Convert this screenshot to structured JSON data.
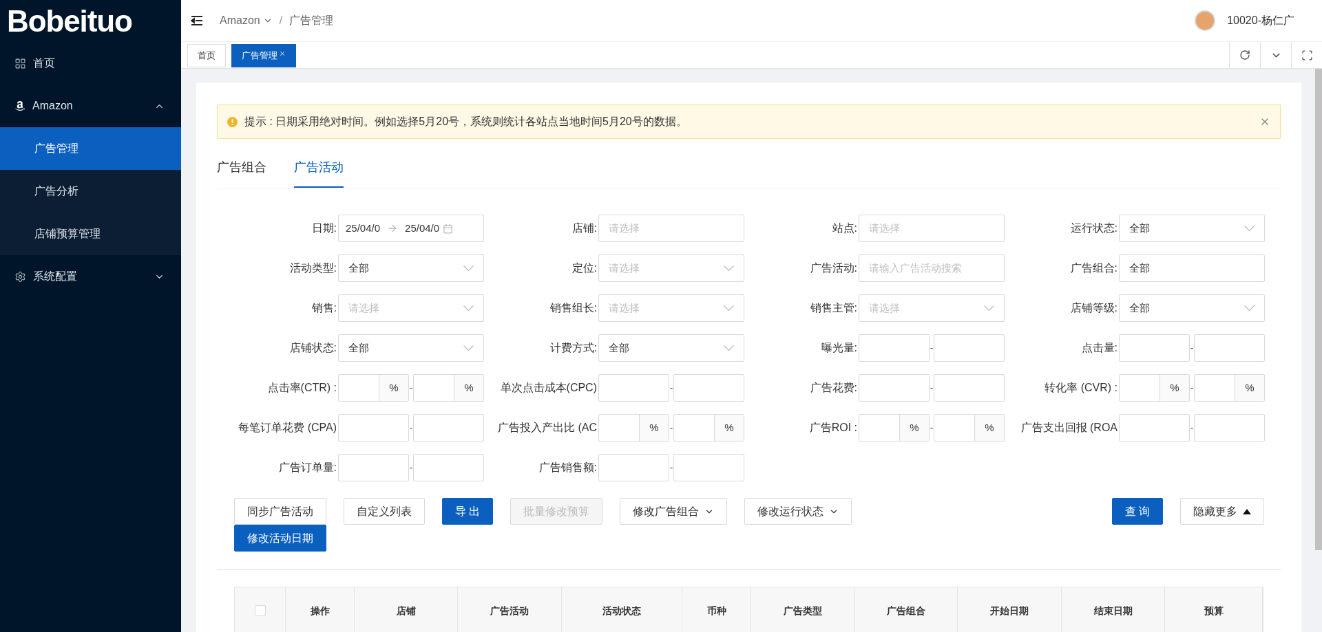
{
  "sidebar": {
    "logo": "Bobeituo",
    "items": [
      {
        "label": "首页",
        "kind": "link",
        "selected": false
      },
      {
        "label": "Amazon",
        "kind": "group",
        "expanded": true,
        "children": [
          {
            "label": "广告管理",
            "selected": true
          },
          {
            "label": "广告分析",
            "selected": false
          },
          {
            "label": "店铺预算管理",
            "selected": false
          }
        ]
      },
      {
        "label": "系统配置",
        "kind": "group",
        "expanded": false
      }
    ]
  },
  "header": {
    "breadcrumb": [
      {
        "label": "Amazon",
        "dropdown": true
      },
      {
        "label": "广告管理",
        "dropdown": false
      }
    ],
    "separator": "/",
    "user": {
      "name": "10020-杨仁广"
    }
  },
  "page_tabs": [
    {
      "label": "首页",
      "selected": false,
      "closable": false
    },
    {
      "label": "广告管理",
      "selected": true,
      "closable": true
    }
  ],
  "alert": {
    "text": "提示 : 日期采用绝对时间。例如选择5月20号，系统则统计各站点当地时间5月20号的数据。"
  },
  "content_tabs": [
    {
      "label": "广告组合",
      "selected": false
    },
    {
      "label": "广告活动",
      "selected": true
    }
  ],
  "filters": [
    {
      "label": "日期:",
      "kind": "date_range",
      "start": "25/04/0",
      "end": "25/04/0"
    },
    {
      "label": "店铺:",
      "kind": "input",
      "placeholder": "请选择"
    },
    {
      "label": "站点:",
      "kind": "input",
      "placeholder": "请选择"
    },
    {
      "label": "运行状态:",
      "kind": "select",
      "value": "全部"
    },
    {
      "label": "活动类型:",
      "kind": "select",
      "value": "全部"
    },
    {
      "label": "定位:",
      "kind": "select",
      "placeholder": "请选择"
    },
    {
      "label": "广告活动:",
      "kind": "input",
      "placeholder": "请输入广告活动搜索"
    },
    {
      "label": "广告组合:",
      "kind": "input",
      "value": "全部"
    },
    {
      "label": "销售:",
      "kind": "select",
      "placeholder": "请选择"
    },
    {
      "label": "销售组长:",
      "kind": "select",
      "placeholder": "请选择"
    },
    {
      "label": "销售主管:",
      "kind": "select",
      "placeholder": "请选择"
    },
    {
      "label": "店铺等级:",
      "kind": "select",
      "value": "全部"
    },
    {
      "label": "店铺状态:",
      "kind": "select",
      "value": "全部"
    },
    {
      "label": "计费方式:",
      "kind": "select",
      "value": "全部"
    },
    {
      "label": "曝光量:",
      "kind": "range",
      "separator": "-"
    },
    {
      "label": "点击量:",
      "kind": "range",
      "separator": "-"
    },
    {
      "label": "点击率(CTR) :",
      "kind": "percent_range",
      "separator": "-",
      "unit": "%"
    },
    {
      "label": "单次点击成本(CPC)",
      "kind": "range",
      "separator": "-"
    },
    {
      "label": "广告花费:",
      "kind": "range",
      "separator": "-"
    },
    {
      "label": "转化率 (CVR) :",
      "kind": "percent_range",
      "separator": "-",
      "unit": "%"
    },
    {
      "label": "每笔订单花费 (CPA)",
      "kind": "range",
      "separator": "-"
    },
    {
      "label": "广告投入产出比 (AC",
      "kind": "percent_range",
      "separator": "-",
      "unit": "%"
    },
    {
      "label": "广告ROI :",
      "kind": "percent_range",
      "separator": "-",
      "unit": "%"
    },
    {
      "label": "广告支出回报 (ROA",
      "kind": "range",
      "separator": "-"
    },
    {
      "label": "广告订单量:",
      "kind": "range",
      "separator": "-"
    },
    {
      "label": "广告销售额:",
      "kind": "range",
      "separator": "-"
    }
  ],
  "actions": [
    {
      "label": "同步广告活动",
      "kind": "default"
    },
    {
      "label": "自定义列表",
      "kind": "default"
    },
    {
      "label": "导 出",
      "kind": "primary"
    },
    {
      "label": "批量修改预算",
      "kind": "disabled"
    },
    {
      "label": "修改广告组合",
      "kind": "dropdown"
    },
    {
      "label": "修改运行状态",
      "kind": "dropdown"
    },
    {
      "label": "修改活动日期",
      "kind": "primary"
    }
  ],
  "right_actions": [
    {
      "label": "查 询",
      "kind": "primary"
    },
    {
      "label": "隐藏更多",
      "kind": "collapse"
    }
  ],
  "table": {
    "select_all": {
      "checked": false
    },
    "columns": [
      "操作",
      "店铺",
      "广告活动",
      "活动状态",
      "币种",
      "广告类型",
      "广告组合",
      "开始日期",
      "结束日期",
      "预算"
    ]
  }
}
